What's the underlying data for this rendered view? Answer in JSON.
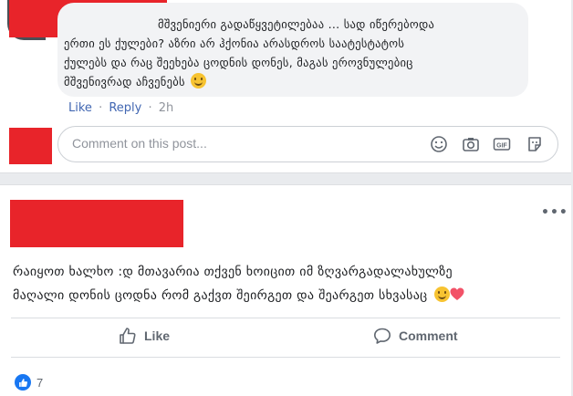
{
  "reply_comment": {
    "lines": [
      "მშვენიერი გადაწყვეტილებაა ... სად იწერებოდა",
      "ერთი ეს ქულები? აზრი არ ჰქონია არასდროს საატესტატოს",
      "ქულებს და რაც შეეხება ცოდნის დონეს, მაგას ეროვნულებიც",
      "მშვენივრად აჩვენებს"
    ],
    "emoji": "slightly-smiling-face",
    "like_label": "Like",
    "reply_label": "Reply",
    "separator": "·",
    "timestamp": "2h"
  },
  "comment_input": {
    "placeholder": "Comment on this post...",
    "icons": [
      "emoji-icon",
      "camera-icon",
      "gif-icon",
      "sticker-icon"
    ]
  },
  "post": {
    "lines": [
      "რაიყოთ ხალხო :დ მთავარია თქვენ ხოიცით იმ ზღვარგადალახულზე",
      "მაღალი დონის ცოდნა რომ გაქვთ შეირგეთ და შეარგეთ სხვასაც"
    ],
    "emojis": [
      "grinning-face",
      "red-heart"
    ],
    "like_button_label": "Like",
    "comment_button_label": "Comment",
    "reaction_count": "7"
  },
  "colors": {
    "link": "#4267b2",
    "redaction": "#e8242a",
    "like_blue": "#1877f2",
    "muted": "#606770"
  }
}
